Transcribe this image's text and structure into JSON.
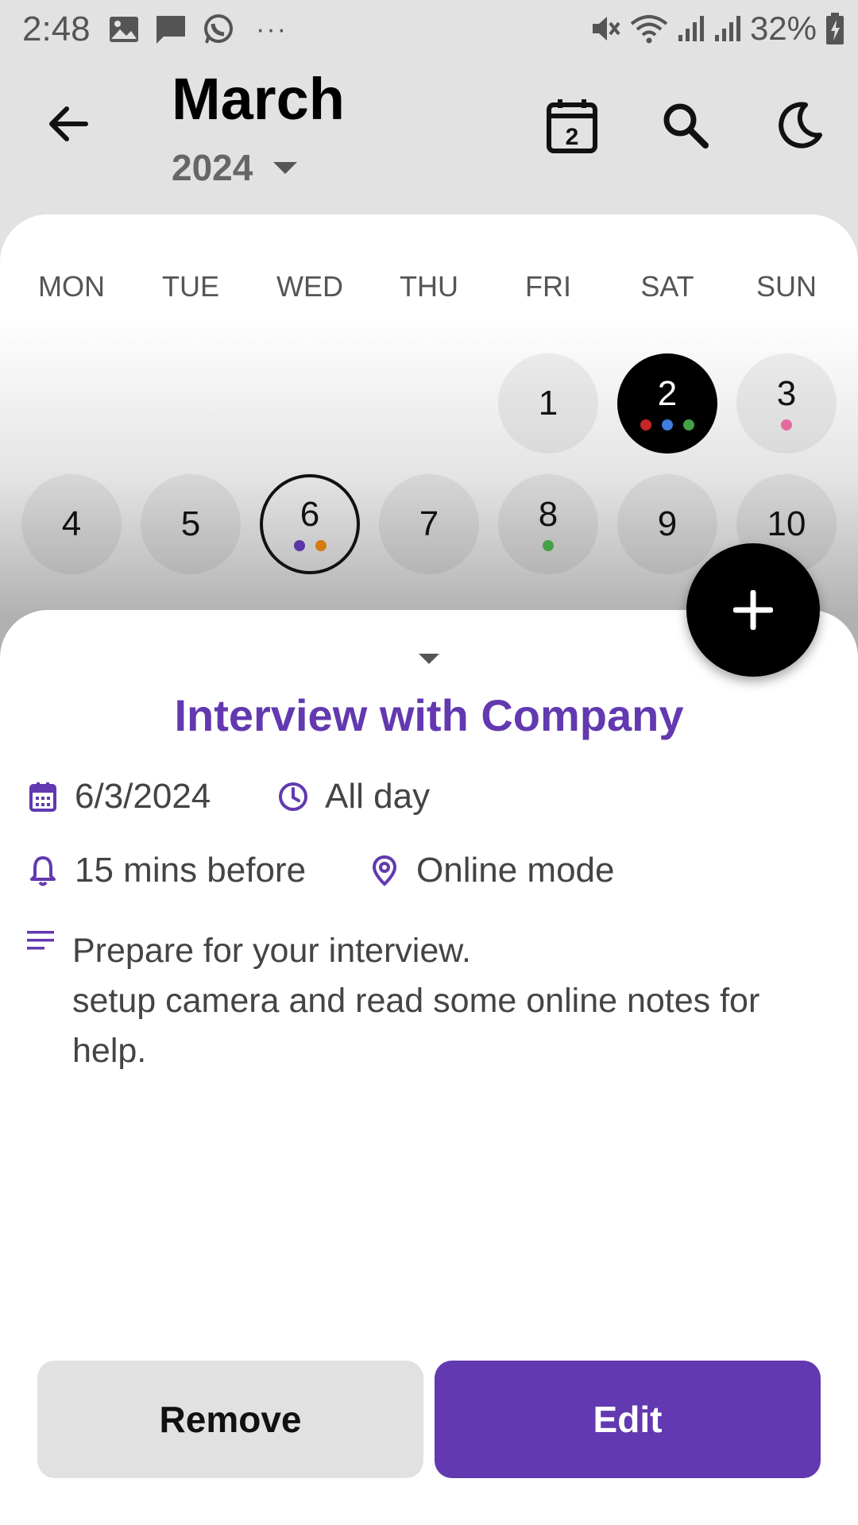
{
  "status_bar": {
    "time": "2:48",
    "battery": "32%",
    "more": "···",
    "icons": [
      "image-icon",
      "message-icon",
      "whatsapp-icon",
      "mute-icon",
      "wifi-icon",
      "signal-icon",
      "signal-icon",
      "battery-icon"
    ]
  },
  "header": {
    "month": "March",
    "year": "2024",
    "today_badge": "2"
  },
  "weekdays": [
    "MON",
    "TUE",
    "WED",
    "THU",
    "FRI",
    "SAT",
    "SUN"
  ],
  "days": [
    {
      "num": "1"
    },
    {
      "num": "2",
      "state": "selected",
      "dots": [
        "#c62828",
        "#3f7de0",
        "#43a047"
      ]
    },
    {
      "num": "3",
      "dots": [
        "#e56aa0"
      ]
    },
    {
      "num": "4"
    },
    {
      "num": "5"
    },
    {
      "num": "6",
      "state": "today",
      "dots": [
        "#5a36a6",
        "#d47a10"
      ]
    },
    {
      "num": "7"
    },
    {
      "num": "8",
      "dots": [
        "#43a047"
      ]
    },
    {
      "num": "9"
    },
    {
      "num": "10"
    }
  ],
  "event": {
    "title": "Interview with Company",
    "date": "6/3/2024",
    "time": "All day",
    "reminder": "15 mins before",
    "location": "Online mode",
    "description_lines": [
      "Prepare for your interview.",
      "setup camera and read some online notes for",
      "help."
    ]
  },
  "actions": {
    "remove": "Remove",
    "edit": "Edit"
  },
  "colors": {
    "accent": "#6239b0",
    "background": "#e2e2e2",
    "fab": "#000000"
  }
}
